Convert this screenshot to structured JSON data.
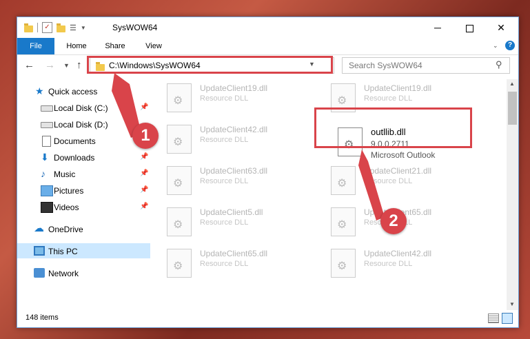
{
  "window": {
    "title": "SysWOW64",
    "controls": {
      "minimize": "─",
      "close": "✕"
    }
  },
  "ribbon": {
    "tabs": [
      "File",
      "Home",
      "Share",
      "View"
    ],
    "help": "?"
  },
  "nav": {
    "address": "C:\\Windows\\SysWOW64",
    "search_placeholder": "Search SysWOW64"
  },
  "sidebar": {
    "items": [
      {
        "label": "Quick access",
        "icon": "star-icon"
      },
      {
        "label": "Local Disk (C:)",
        "icon": "drive-icon"
      },
      {
        "label": "Local Disk (D:)",
        "icon": "drive-icon"
      },
      {
        "label": "Documents",
        "icon": "documents-icon"
      },
      {
        "label": "Downloads",
        "icon": "downloads-icon"
      },
      {
        "label": "Music",
        "icon": "music-icon"
      },
      {
        "label": "Pictures",
        "icon": "pictures-icon"
      },
      {
        "label": "Videos",
        "icon": "videos-icon"
      },
      {
        "label": "OneDrive",
        "icon": "onedrive-icon"
      },
      {
        "label": "This PC",
        "icon": "this-pc-icon"
      },
      {
        "label": "Network",
        "icon": "network-icon"
      }
    ]
  },
  "files": [
    {
      "name": "UpdateClient19.dll",
      "type": "Resource DLL"
    },
    {
      "name": "UpdateClient19.dll",
      "type": "Resource DLL"
    },
    {
      "name": "UpdateClient42.dll",
      "type": "Resource DLL"
    },
    {
      "name": "outllib.dll",
      "version": "9.0.0.2711",
      "company": "Microsoft Outlook"
    },
    {
      "name": "UpdateClient63.dll",
      "type": "Resource DLL"
    },
    {
      "name": "UpdateClient21.dll",
      "type": "Resource DLL"
    },
    {
      "name": "UpdateClient5.dll",
      "type": "Resource DLL"
    },
    {
      "name": "UpdateClient65.dll",
      "type": "Resource DLL"
    },
    {
      "name": "UpdateClient65.dll",
      "type": "Resource DLL"
    },
    {
      "name": "UpdateClient42.dll",
      "type": "Resource DLL"
    }
  ],
  "status": {
    "item_count": "148 items"
  },
  "annotations": {
    "step1": "1",
    "step2": "2",
    "color": "#d9444a"
  }
}
